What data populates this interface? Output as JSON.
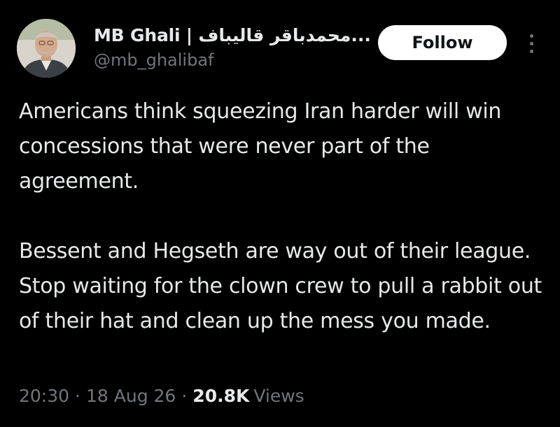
{
  "author": {
    "display_name": "MB Ghali | محمدباقر قالیباف...",
    "handle": "@mb_ghalibaf",
    "avatar_icon": "profile-photo"
  },
  "actions": {
    "follow_label": "Follow",
    "more_icon": "vertical-ellipsis-icon"
  },
  "tweet": {
    "paragraph_1": "Americans think squeezing Iran harder will win concessions that were never part of the agreement.",
    "paragraph_2": "Bessent and Hegseth are way out of their league. Stop waiting for the clown crew to pull a rabbit out of their hat and clean up the mess you made."
  },
  "meta": {
    "time": "20:30",
    "date": "18 Aug 26",
    "separator": "·",
    "views_count": "20.8K",
    "views_label": "Views"
  },
  "colors": {
    "background": "#000000",
    "primary_text": "#e7e9ea",
    "secondary_text": "#71767b",
    "follow_button_bg": "#ffffff",
    "follow_button_text": "#0f1419"
  }
}
